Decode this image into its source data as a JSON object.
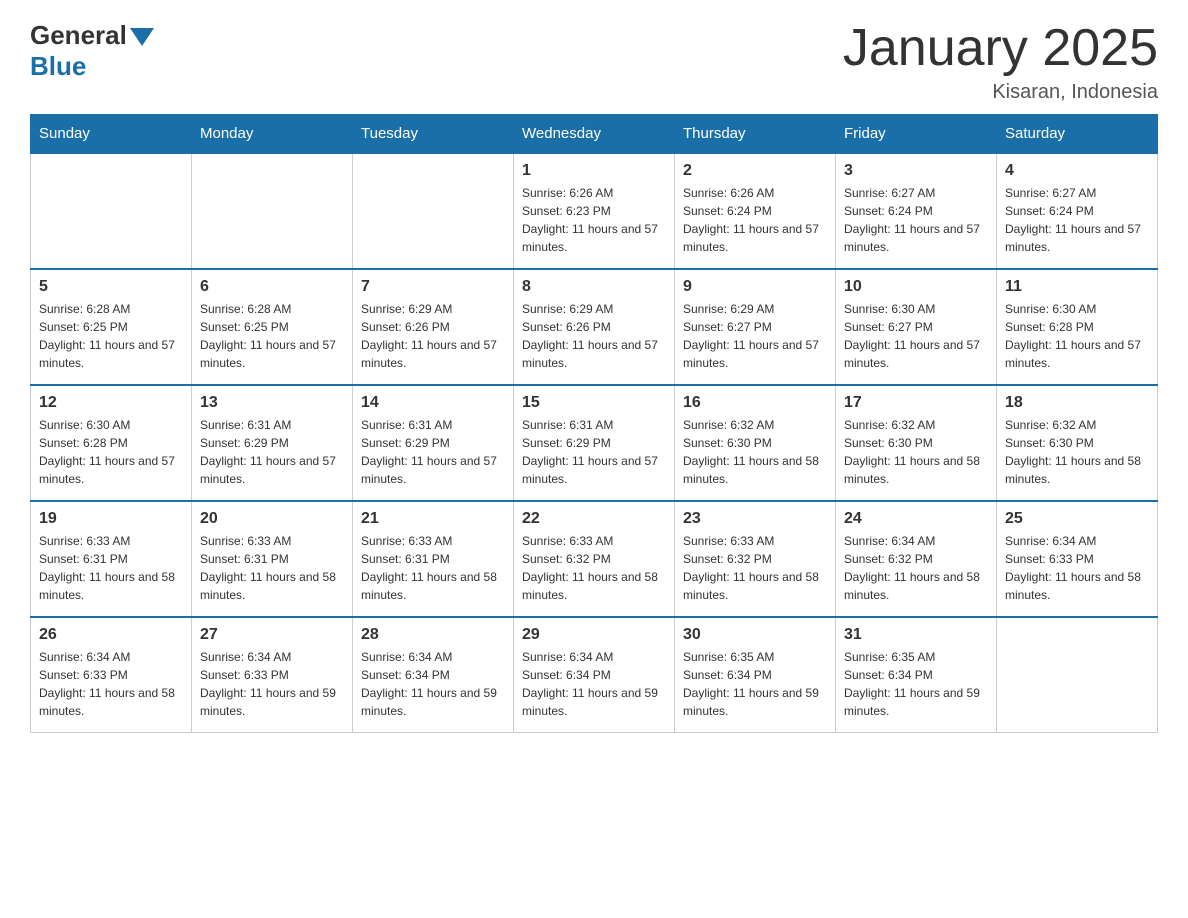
{
  "logo": {
    "general": "General",
    "blue": "Blue",
    "triangle": "▼"
  },
  "header": {
    "title": "January 2025",
    "location": "Kisaran, Indonesia"
  },
  "weekdays": [
    "Sunday",
    "Monday",
    "Tuesday",
    "Wednesday",
    "Thursday",
    "Friday",
    "Saturday"
  ],
  "weeks": [
    [
      {
        "day": "",
        "info": ""
      },
      {
        "day": "",
        "info": ""
      },
      {
        "day": "",
        "info": ""
      },
      {
        "day": "1",
        "info": "Sunrise: 6:26 AM\nSunset: 6:23 PM\nDaylight: 11 hours and 57 minutes."
      },
      {
        "day": "2",
        "info": "Sunrise: 6:26 AM\nSunset: 6:24 PM\nDaylight: 11 hours and 57 minutes."
      },
      {
        "day": "3",
        "info": "Sunrise: 6:27 AM\nSunset: 6:24 PM\nDaylight: 11 hours and 57 minutes."
      },
      {
        "day": "4",
        "info": "Sunrise: 6:27 AM\nSunset: 6:24 PM\nDaylight: 11 hours and 57 minutes."
      }
    ],
    [
      {
        "day": "5",
        "info": "Sunrise: 6:28 AM\nSunset: 6:25 PM\nDaylight: 11 hours and 57 minutes."
      },
      {
        "day": "6",
        "info": "Sunrise: 6:28 AM\nSunset: 6:25 PM\nDaylight: 11 hours and 57 minutes."
      },
      {
        "day": "7",
        "info": "Sunrise: 6:29 AM\nSunset: 6:26 PM\nDaylight: 11 hours and 57 minutes."
      },
      {
        "day": "8",
        "info": "Sunrise: 6:29 AM\nSunset: 6:26 PM\nDaylight: 11 hours and 57 minutes."
      },
      {
        "day": "9",
        "info": "Sunrise: 6:29 AM\nSunset: 6:27 PM\nDaylight: 11 hours and 57 minutes."
      },
      {
        "day": "10",
        "info": "Sunrise: 6:30 AM\nSunset: 6:27 PM\nDaylight: 11 hours and 57 minutes."
      },
      {
        "day": "11",
        "info": "Sunrise: 6:30 AM\nSunset: 6:28 PM\nDaylight: 11 hours and 57 minutes."
      }
    ],
    [
      {
        "day": "12",
        "info": "Sunrise: 6:30 AM\nSunset: 6:28 PM\nDaylight: 11 hours and 57 minutes."
      },
      {
        "day": "13",
        "info": "Sunrise: 6:31 AM\nSunset: 6:29 PM\nDaylight: 11 hours and 57 minutes."
      },
      {
        "day": "14",
        "info": "Sunrise: 6:31 AM\nSunset: 6:29 PM\nDaylight: 11 hours and 57 minutes."
      },
      {
        "day": "15",
        "info": "Sunrise: 6:31 AM\nSunset: 6:29 PM\nDaylight: 11 hours and 57 minutes."
      },
      {
        "day": "16",
        "info": "Sunrise: 6:32 AM\nSunset: 6:30 PM\nDaylight: 11 hours and 58 minutes."
      },
      {
        "day": "17",
        "info": "Sunrise: 6:32 AM\nSunset: 6:30 PM\nDaylight: 11 hours and 58 minutes."
      },
      {
        "day": "18",
        "info": "Sunrise: 6:32 AM\nSunset: 6:30 PM\nDaylight: 11 hours and 58 minutes."
      }
    ],
    [
      {
        "day": "19",
        "info": "Sunrise: 6:33 AM\nSunset: 6:31 PM\nDaylight: 11 hours and 58 minutes."
      },
      {
        "day": "20",
        "info": "Sunrise: 6:33 AM\nSunset: 6:31 PM\nDaylight: 11 hours and 58 minutes."
      },
      {
        "day": "21",
        "info": "Sunrise: 6:33 AM\nSunset: 6:31 PM\nDaylight: 11 hours and 58 minutes."
      },
      {
        "day": "22",
        "info": "Sunrise: 6:33 AM\nSunset: 6:32 PM\nDaylight: 11 hours and 58 minutes."
      },
      {
        "day": "23",
        "info": "Sunrise: 6:33 AM\nSunset: 6:32 PM\nDaylight: 11 hours and 58 minutes."
      },
      {
        "day": "24",
        "info": "Sunrise: 6:34 AM\nSunset: 6:32 PM\nDaylight: 11 hours and 58 minutes."
      },
      {
        "day": "25",
        "info": "Sunrise: 6:34 AM\nSunset: 6:33 PM\nDaylight: 11 hours and 58 minutes."
      }
    ],
    [
      {
        "day": "26",
        "info": "Sunrise: 6:34 AM\nSunset: 6:33 PM\nDaylight: 11 hours and 58 minutes."
      },
      {
        "day": "27",
        "info": "Sunrise: 6:34 AM\nSunset: 6:33 PM\nDaylight: 11 hours and 59 minutes."
      },
      {
        "day": "28",
        "info": "Sunrise: 6:34 AM\nSunset: 6:34 PM\nDaylight: 11 hours and 59 minutes."
      },
      {
        "day": "29",
        "info": "Sunrise: 6:34 AM\nSunset: 6:34 PM\nDaylight: 11 hours and 59 minutes."
      },
      {
        "day": "30",
        "info": "Sunrise: 6:35 AM\nSunset: 6:34 PM\nDaylight: 11 hours and 59 minutes."
      },
      {
        "day": "31",
        "info": "Sunrise: 6:35 AM\nSunset: 6:34 PM\nDaylight: 11 hours and 59 minutes."
      },
      {
        "day": "",
        "info": ""
      }
    ]
  ]
}
